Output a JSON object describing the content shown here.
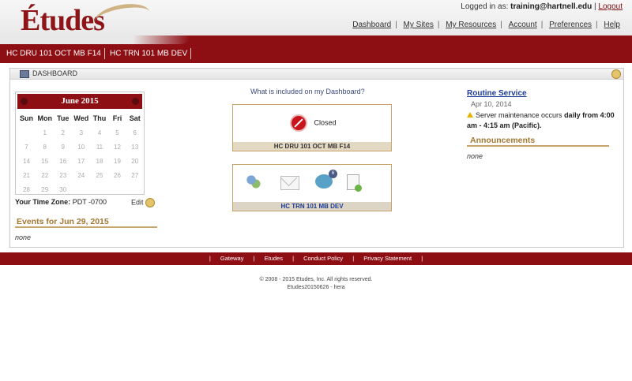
{
  "header": {
    "logo_text": "Études",
    "logged_in_label": "Logged in as:",
    "user": "training@hartnell.edu",
    "logout": "Logout",
    "nav": [
      "Dashboard",
      "My Sites",
      "My Resources",
      "Account",
      "Preferences",
      "Help"
    ]
  },
  "sites_bar": {
    "tabs": [
      "HC DRU 101 OCT MB F14",
      "HC TRN 101 MB DEV"
    ]
  },
  "dashboard": {
    "title": "DASHBOARD",
    "calendar": {
      "month_label": "June 2015",
      "weekdays": [
        "Sun",
        "Mon",
        "Tue",
        "Wed",
        "Thu",
        "Fri",
        "Sat"
      ],
      "weeks": [
        [
          "",
          "1",
          "2",
          "3",
          "4",
          "5",
          "6"
        ],
        [
          "7",
          "8",
          "9",
          "10",
          "11",
          "12",
          "13"
        ],
        [
          "14",
          "15",
          "16",
          "17",
          "18",
          "19",
          "20"
        ],
        [
          "21",
          "22",
          "23",
          "24",
          "25",
          "26",
          "27"
        ],
        [
          "28",
          "29",
          "30",
          "",
          "",
          "",
          ""
        ]
      ]
    },
    "timezone_label": "Your Time Zone:",
    "timezone_value": "PDT -0700",
    "edit_label": "Edit",
    "events_title": "Events for Jun 29, 2015",
    "events_none": "none",
    "included_link": "What is included on my Dashboard?",
    "site1": {
      "status": "Closed",
      "label": "HC DRU 101 OCT MB F14"
    },
    "site2": {
      "label": "HC TRN 101 MB DEV",
      "forum_badge": "6"
    },
    "routine": {
      "title": "Routine Service",
      "date": "Apr 10, 2014",
      "text_normal": "Server maintenance occurs ",
      "text_bold": "daily from 4:00 am - 4:15 am (Pacific)."
    },
    "announcements_title": "Announcements",
    "announcements_none": "none"
  },
  "footer": {
    "links": [
      "Gateway",
      "Etudes",
      "Conduct Policy",
      "Privacy Statement"
    ],
    "copyright": "© 2008 - 2015 Etudes, Inc. All rights reserved.",
    "version": "Etudes20150626 - hera"
  }
}
